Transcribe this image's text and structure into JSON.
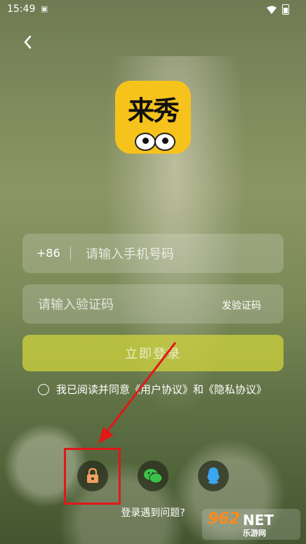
{
  "status_bar": {
    "time": "15:49",
    "sim_icon": "sim-card-icon",
    "wifi_icon": "wifi-icon",
    "battery_icon": "battery-icon"
  },
  "header": {
    "back_icon": "chevron-left-icon"
  },
  "logo": {
    "text": "来秀"
  },
  "phone": {
    "country_code": "+86",
    "placeholder": "请输入手机号码"
  },
  "code": {
    "placeholder": "请输入验证码",
    "send_label": "发验证码"
  },
  "login": {
    "label": "立即登录"
  },
  "agreement": {
    "text": "我已阅读并同意《用户协议》和《隐私协议》"
  },
  "social": {
    "lock_icon": "lock-icon",
    "wechat_icon": "wechat-icon",
    "qq_icon": "qq-icon"
  },
  "help": {
    "label": "登录遇到问题?"
  },
  "watermark": {
    "main": "962",
    "net": "NET",
    "sub": "乐游网"
  },
  "colors": {
    "logo": "#f6c21c",
    "login_button": "#d2d73c",
    "highlight": "#e01818"
  }
}
